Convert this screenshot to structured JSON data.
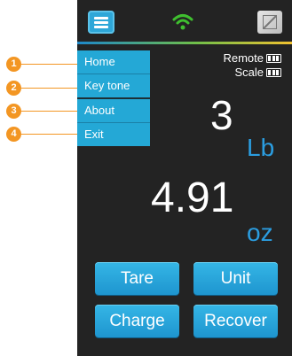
{
  "annotations": [
    {
      "number": "1"
    },
    {
      "number": "2"
    },
    {
      "number": "3"
    },
    {
      "number": "4"
    }
  ],
  "menu": {
    "items": [
      "Home",
      "Key tone",
      "About",
      "Exit"
    ]
  },
  "status": {
    "remote_label": "Remote",
    "scale_label": "Scale",
    "remote_battery_level": 1.0,
    "scale_battery_level": 1.0
  },
  "readout": {
    "pounds_value": "3",
    "pounds_unit": "Lb",
    "ounces_value": "4.91",
    "ounces_unit": "oz"
  },
  "buttons": {
    "tare": "Tare",
    "unit": "Unit",
    "charge": "Charge",
    "recover": "Recover"
  },
  "colors": {
    "accent": "#24a8d6",
    "annotation": "#f39623",
    "wifi": "#3fbf2f",
    "unit_text": "#2b9de0",
    "background": "#232323"
  },
  "icons": [
    "hamburger-menu-icon",
    "wifi-icon",
    "screen-toggle-icon",
    "battery-icon"
  ]
}
